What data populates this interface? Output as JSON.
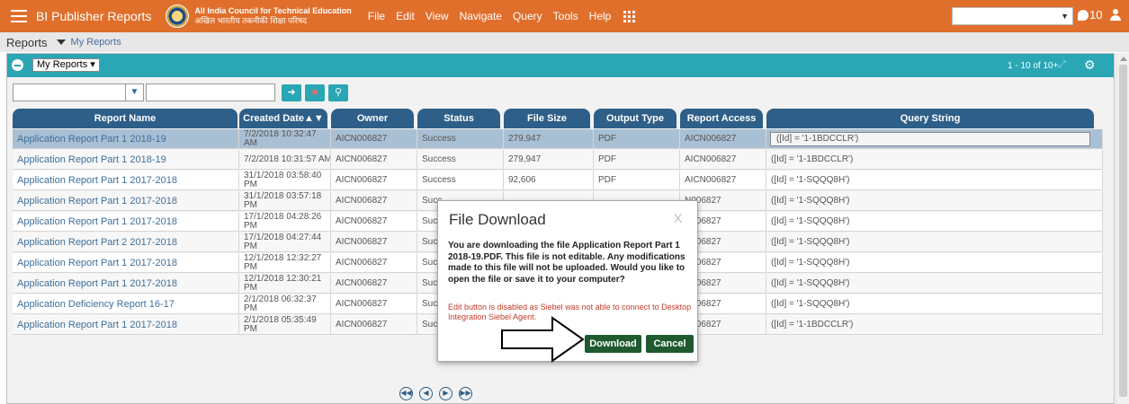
{
  "topbar": {
    "app_title": "BI Publisher Reports",
    "org_name_en": "All India Council for Technical Education",
    "org_name_hi": "अखिल भारतीय तकनीकी शिक्षा परिषद",
    "menu": [
      "File",
      "Edit",
      "View",
      "Navigate",
      "Query",
      "Tools",
      "Help"
    ],
    "notification_count": "10",
    "brand_color": "#e06f2c"
  },
  "breadcrumb": {
    "main": "Reports",
    "sub": "My Reports"
  },
  "applet": {
    "view_selector": "My Reports",
    "record_count": "1 - 10 of 10+",
    "query_input_value": "",
    "accent_color": "#2aa6b4"
  },
  "table": {
    "columns": [
      "Report Name",
      "Created Date▲▼",
      "Owner",
      "Status",
      "File Size",
      "Output Type",
      "Report Access",
      "Query String"
    ],
    "rows": [
      {
        "name": "Application Report Part 1 2018-19",
        "date": "7/2/2018 10:32:47 AM",
        "owner": "AICN006827",
        "status": "Success",
        "size": "279,947",
        "type": "PDF",
        "access": "AICN006827",
        "query": "([Id] = '1-1BDCCLR')",
        "selected": true
      },
      {
        "name": "Application Report Part 1 2018-19",
        "date": "7/2/2018 10:31:57 AM",
        "owner": "AICN006827",
        "status": "Success",
        "size": "279,947",
        "type": "PDF",
        "access": "AICN006827",
        "query": "([Id] = '1-1BDCCLR')"
      },
      {
        "name": "Application Report Part 1 2017-2018",
        "date": "31/1/2018 03:58:40 PM",
        "owner": "AICN006827",
        "status": "Success",
        "size": "92,606",
        "type": "PDF",
        "access": "AICN006827",
        "query": "([Id] = '1-SQQQ8H')"
      },
      {
        "name": "Application Report Part 1 2017-2018",
        "date": "31/1/2018 03:57:18 PM",
        "owner": "AICN006827",
        "status": "Succ",
        "size": "",
        "type": "",
        "access": "N006827",
        "query": "([Id] = '1-SQQQ8H')"
      },
      {
        "name": "Application Report Part 1 2017-2018",
        "date": "17/1/2018 04:28:26 PM",
        "owner": "AICN006827",
        "status": "Succ",
        "size": "",
        "type": "",
        "access": "N006827",
        "query": "([Id] = '1-SQQQ8H')"
      },
      {
        "name": "Application Report Part 2 2017-2018",
        "date": "17/1/2018 04:27:44 PM",
        "owner": "AICN006827",
        "status": "Succ",
        "size": "",
        "type": "",
        "access": "N006827",
        "query": "([Id] = '1-SQQQ8H')"
      },
      {
        "name": "Application Report Part 1 2017-2018",
        "date": "12/1/2018 12:32:27 PM",
        "owner": "AICN006827",
        "status": "Succ",
        "size": "",
        "type": "",
        "access": "N006827",
        "query": "([Id] = '1-SQQQ8H')"
      },
      {
        "name": "Application Report Part 1 2017-2018",
        "date": "12/1/2018 12:30:21 PM",
        "owner": "AICN006827",
        "status": "Succ",
        "size": "",
        "type": "",
        "access": "N006827",
        "query": "([Id] = '1-SQQQ8H')"
      },
      {
        "name": "Application Deficiency Report 16-17",
        "date": "2/1/2018 06:32:37 PM",
        "owner": "AICN006827",
        "status": "Succ",
        "size": "",
        "type": "",
        "access": "N006827",
        "query": "([Id] = '1-SQQQ8H')"
      },
      {
        "name": "Application Report Part 1 2017-2018",
        "date": "2/1/2018 05:35:49 PM",
        "owner": "AICN006827",
        "status": "Succ",
        "size": "",
        "type": "",
        "access": "N006827",
        "query": "([Id] = '1-1BDCCLR')"
      }
    ]
  },
  "dialog": {
    "title": "File Download",
    "close_glyph": "X",
    "message": "You are downloading the file Application Report Part 1 2018-19.PDF. This file is not editable. Any modifications made to this file will not be uploaded. Would you like to open the file or save it to your computer?",
    "warning": "Edit button is disabled as Siebel was not able to connect to Desktop Integration Siebel Agent.",
    "download_label": "Download",
    "cancel_label": "Cancel",
    "button_color": "#1f5a2f",
    "warning_color": "#c23b2b"
  },
  "icons": {
    "query_go": "go-icon",
    "query_delete": "delete-icon",
    "query_search": "search-icon",
    "pager": [
      "first-page-icon",
      "previous-page-icon",
      "next-page-icon",
      "last-page-icon"
    ]
  }
}
